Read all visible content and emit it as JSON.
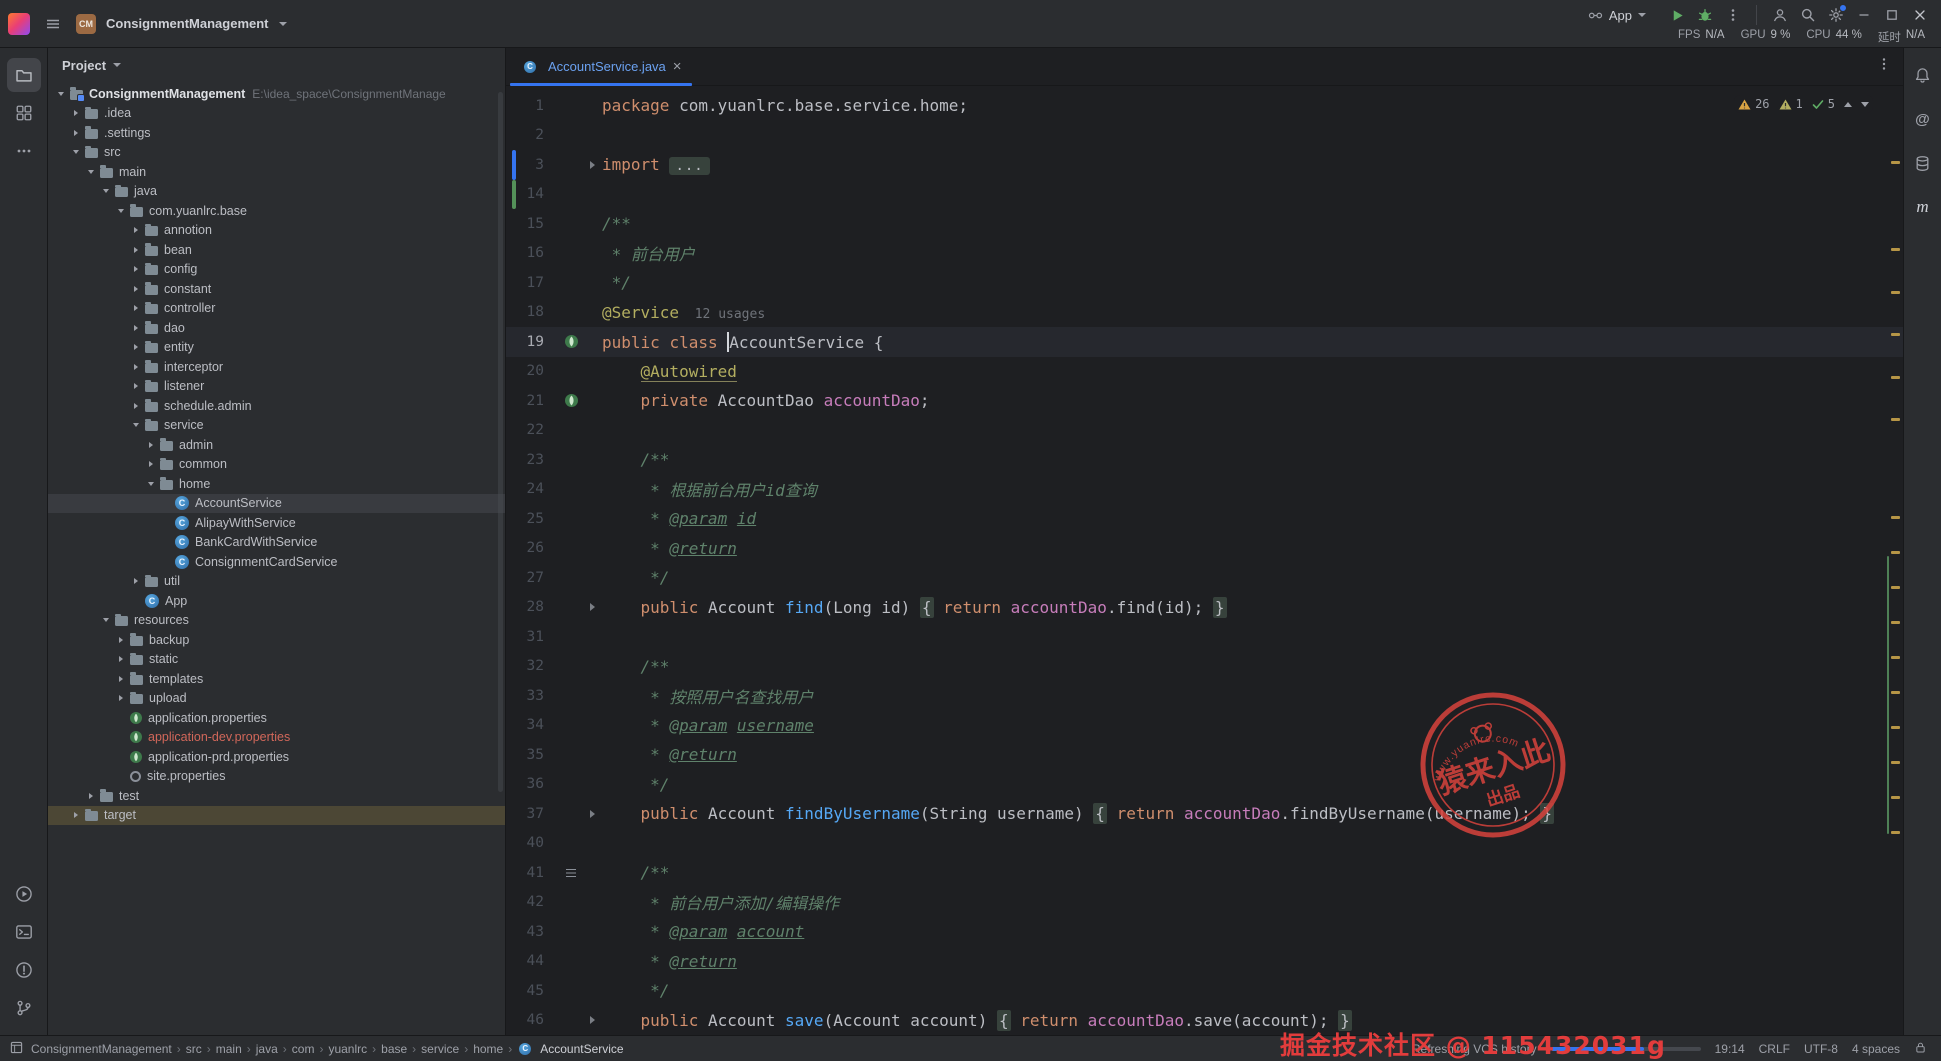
{
  "titlebar": {
    "project_badge": "CM",
    "project_name": "ConsignmentManagement",
    "run_config": "App",
    "stats": [
      {
        "label": "FPS",
        "value": "N/A"
      },
      {
        "label": "GPU",
        "value": "9 %"
      },
      {
        "label": "CPU",
        "value": "44 %"
      },
      {
        "label": "延时",
        "value": "N/A"
      }
    ]
  },
  "project_panel": {
    "title": "Project",
    "tree": [
      {
        "label": "ConsignmentManagement",
        "hint": "E:\\idea_space\\ConsignmentManage",
        "level": 0,
        "icon": "project",
        "state": "expanded",
        "bold": true
      },
      {
        "label": ".idea",
        "level": 1,
        "icon": "folder",
        "state": "collapsed"
      },
      {
        "label": ".settings",
        "level": 1,
        "icon": "folder",
        "state": "collapsed"
      },
      {
        "label": "src",
        "level": 1,
        "icon": "folder",
        "state": "expanded"
      },
      {
        "label": "main",
        "level": 2,
        "icon": "folder",
        "state": "expanded"
      },
      {
        "label": "java",
        "level": 3,
        "icon": "folder",
        "state": "expanded"
      },
      {
        "label": "com.yuanlrc.base",
        "level": 4,
        "icon": "package",
        "state": "expanded"
      },
      {
        "label": "annotion",
        "level": 5,
        "icon": "package",
        "state": "collapsed"
      },
      {
        "label": "bean",
        "level": 5,
        "icon": "package",
        "state": "collapsed"
      },
      {
        "label": "config",
        "level": 5,
        "icon": "package",
        "state": "collapsed"
      },
      {
        "label": "constant",
        "level": 5,
        "icon": "package",
        "state": "collapsed"
      },
      {
        "label": "controller",
        "level": 5,
        "icon": "package",
        "state": "collapsed"
      },
      {
        "label": "dao",
        "level": 5,
        "icon": "package",
        "state": "collapsed"
      },
      {
        "label": "entity",
        "level": 5,
        "icon": "package",
        "state": "collapsed"
      },
      {
        "label": "interceptor",
        "level": 5,
        "icon": "package",
        "state": "collapsed"
      },
      {
        "label": "listener",
        "level": 5,
        "icon": "package",
        "state": "collapsed"
      },
      {
        "label": "schedule.admin",
        "level": 5,
        "icon": "package",
        "state": "collapsed"
      },
      {
        "label": "service",
        "level": 5,
        "icon": "package",
        "state": "expanded"
      },
      {
        "label": "admin",
        "level": 6,
        "icon": "package",
        "state": "collapsed"
      },
      {
        "label": "common",
        "level": 6,
        "icon": "package",
        "state": "collapsed"
      },
      {
        "label": "home",
        "level": 6,
        "icon": "package",
        "state": "expanded"
      },
      {
        "label": "AccountService",
        "level": 7,
        "icon": "class",
        "selected": true
      },
      {
        "label": "AlipayWithService",
        "level": 7,
        "icon": "class"
      },
      {
        "label": "BankCardWithService",
        "level": 7,
        "icon": "class"
      },
      {
        "label": "ConsignmentCardService",
        "level": 7,
        "icon": "class"
      },
      {
        "label": "util",
        "level": 5,
        "icon": "package",
        "state": "collapsed"
      },
      {
        "label": "App",
        "level": 5,
        "icon": "class"
      },
      {
        "label": "resources",
        "level": 3,
        "icon": "folder",
        "state": "expanded"
      },
      {
        "label": "backup",
        "level": 4,
        "icon": "folder",
        "state": "collapsed"
      },
      {
        "label": "static",
        "level": 4,
        "icon": "folder",
        "state": "collapsed"
      },
      {
        "label": "templates",
        "level": 4,
        "icon": "folder",
        "state": "collapsed"
      },
      {
        "label": "upload",
        "level": 4,
        "icon": "folder",
        "state": "collapsed"
      },
      {
        "label": "application.properties",
        "level": 4,
        "icon": "spring"
      },
      {
        "label": "application-dev.properties",
        "level": 4,
        "icon": "spring",
        "modified": true
      },
      {
        "label": "application-prd.properties",
        "level": 4,
        "icon": "spring"
      },
      {
        "label": "site.properties",
        "level": 4,
        "icon": "props"
      },
      {
        "label": "test",
        "level": 2,
        "icon": "folder",
        "state": "collapsed"
      },
      {
        "label": "target",
        "level": 1,
        "icon": "folder",
        "state": "collapsed",
        "excluded": true
      }
    ]
  },
  "editor": {
    "tab_title": "AccountService.java",
    "inspections": {
      "warnings": "26",
      "weak": "1",
      "ok": "5"
    },
    "lines": [
      {
        "n": 1,
        "t": [
          [
            "k",
            "package"
          ],
          [
            "p",
            " com.yuanlrc.base.service.home;"
          ]
        ]
      },
      {
        "n": 2,
        "t": []
      },
      {
        "n": 3,
        "t": [
          [
            "k",
            "import"
          ],
          [
            "p",
            " "
          ],
          [
            "fold",
            "..."
          ]
        ],
        "f": true,
        "vcs": "blue"
      },
      {
        "n": 14,
        "t": [],
        "vcs": "green"
      },
      {
        "n": 15,
        "t": [
          [
            "d",
            "/**"
          ]
        ]
      },
      {
        "n": 16,
        "t": [
          [
            "d",
            " * 前台用户"
          ]
        ]
      },
      {
        "n": 17,
        "t": [
          [
            "d",
            " */"
          ]
        ]
      },
      {
        "n": 18,
        "t": [
          [
            "a",
            "@Service"
          ],
          [
            "u",
            "  12 usages"
          ]
        ]
      },
      {
        "n": 19,
        "t": [
          [
            "k",
            "public"
          ],
          [
            "p",
            " "
          ],
          [
            "k",
            "class"
          ],
          [
            "p",
            " "
          ],
          [
            "caret",
            ""
          ],
          [
            "p",
            "AccountService {"
          ]
        ],
        "cur": true,
        "g": "bean"
      },
      {
        "n": 20,
        "t": [
          [
            "p",
            "    "
          ],
          [
            "au",
            "@Autowired"
          ]
        ]
      },
      {
        "n": 21,
        "t": [
          [
            "p",
            "    "
          ],
          [
            "k",
            "private"
          ],
          [
            "p",
            " AccountDao "
          ],
          [
            "fld",
            "accountDao"
          ],
          [
            "p",
            ";"
          ]
        ],
        "g": "bean"
      },
      {
        "n": 22,
        "t": []
      },
      {
        "n": 23,
        "t": [
          [
            "p",
            "    "
          ],
          [
            "d",
            "/**"
          ]
        ]
      },
      {
        "n": 24,
        "t": [
          [
            "p",
            "    "
          ],
          [
            "d",
            " * 根据前台用户id查询"
          ]
        ]
      },
      {
        "n": 25,
        "t": [
          [
            "p",
            "    "
          ],
          [
            "d",
            " * "
          ],
          [
            "dt",
            "@param"
          ],
          [
            "d",
            " "
          ],
          [
            "dt",
            "id"
          ]
        ]
      },
      {
        "n": 26,
        "t": [
          [
            "p",
            "    "
          ],
          [
            "d",
            " * "
          ],
          [
            "dt",
            "@return"
          ]
        ]
      },
      {
        "n": 27,
        "t": [
          [
            "p",
            "    "
          ],
          [
            "d",
            " */"
          ]
        ]
      },
      {
        "n": 28,
        "t": [
          [
            "p",
            "    "
          ],
          [
            "k",
            "public"
          ],
          [
            "p",
            " Account "
          ],
          [
            "m",
            "find"
          ],
          [
            "p",
            "(Long id) "
          ],
          [
            "fb",
            "{"
          ],
          [
            "p",
            " "
          ],
          [
            "k",
            "return"
          ],
          [
            "p",
            " "
          ],
          [
            "fld",
            "accountDao"
          ],
          [
            "p",
            ".find(id); "
          ],
          [
            "fb",
            "}"
          ]
        ],
        "f": true
      },
      {
        "n": 31,
        "t": []
      },
      {
        "n": 32,
        "t": [
          [
            "p",
            "    "
          ],
          [
            "d",
            "/**"
          ]
        ]
      },
      {
        "n": 33,
        "t": [
          [
            "p",
            "    "
          ],
          [
            "d",
            " * 按照用户名查找用户"
          ]
        ]
      },
      {
        "n": 34,
        "t": [
          [
            "p",
            "    "
          ],
          [
            "d",
            " * "
          ],
          [
            "dt",
            "@param"
          ],
          [
            "d",
            " "
          ],
          [
            "dt",
            "username"
          ]
        ]
      },
      {
        "n": 35,
        "t": [
          [
            "p",
            "    "
          ],
          [
            "d",
            " * "
          ],
          [
            "dt",
            "@return"
          ]
        ]
      },
      {
        "n": 36,
        "t": [
          [
            "p",
            "    "
          ],
          [
            "d",
            " */"
          ]
        ]
      },
      {
        "n": 37,
        "t": [
          [
            "p",
            "    "
          ],
          [
            "k",
            "public"
          ],
          [
            "p",
            " Account "
          ],
          [
            "m",
            "findByUsername"
          ],
          [
            "p",
            "(String username) "
          ],
          [
            "fb",
            "{"
          ],
          [
            "p",
            " "
          ],
          [
            "k",
            "return"
          ],
          [
            "p",
            " "
          ],
          [
            "fld",
            "accountDao"
          ],
          [
            "p",
            ".findByUsername(username); "
          ],
          [
            "fb",
            "}"
          ]
        ],
        "f": true
      },
      {
        "n": 40,
        "t": []
      },
      {
        "n": 41,
        "t": [
          [
            "p",
            "    "
          ],
          [
            "d",
            "/**"
          ]
        ],
        "g": "list"
      },
      {
        "n": 42,
        "t": [
          [
            "p",
            "    "
          ],
          [
            "d",
            " * 前台用户添加/编辑操作"
          ]
        ]
      },
      {
        "n": 43,
        "t": [
          [
            "p",
            "    "
          ],
          [
            "d",
            " * "
          ],
          [
            "dt",
            "@param"
          ],
          [
            "d",
            " "
          ],
          [
            "dt",
            "account"
          ]
        ]
      },
      {
        "n": 44,
        "t": [
          [
            "p",
            "    "
          ],
          [
            "d",
            " * "
          ],
          [
            "dt",
            "@return"
          ]
        ]
      },
      {
        "n": 45,
        "t": [
          [
            "p",
            "    "
          ],
          [
            "d",
            " */"
          ]
        ]
      },
      {
        "n": 46,
        "t": [
          [
            "p",
            "    "
          ],
          [
            "k",
            "public"
          ],
          [
            "p",
            " Account "
          ],
          [
            "m",
            "save"
          ],
          [
            "p",
            "(Account account) "
          ],
          [
            "fb",
            "{"
          ],
          [
            "p",
            " "
          ],
          [
            "k",
            "return"
          ],
          [
            "p",
            " "
          ],
          [
            "fld",
            "accountDao"
          ],
          [
            "p",
            ".save(account); "
          ],
          [
            "fb",
            "}"
          ]
        ],
        "f": true
      }
    ]
  },
  "right_toolbar": {
    "maven": "m"
  },
  "statusbar": {
    "breadcrumbs": [
      "ConsignmentManagement",
      "src",
      "main",
      "java",
      "com",
      "yuanlrc",
      "base",
      "service",
      "home",
      "AccountService"
    ],
    "vcs_status": "Refreshing VCS history",
    "cursor": "19:14",
    "line_ending": "CRLF",
    "encoding": "UTF-8",
    "indent": "4 spaces"
  },
  "watermark": {
    "juejin": "掘金技术社区 @ 115432031g",
    "stamp_main": "猿来入此",
    "stamp_sub": "出品",
    "stamp_arc": "www.yuanlrc.com"
  }
}
